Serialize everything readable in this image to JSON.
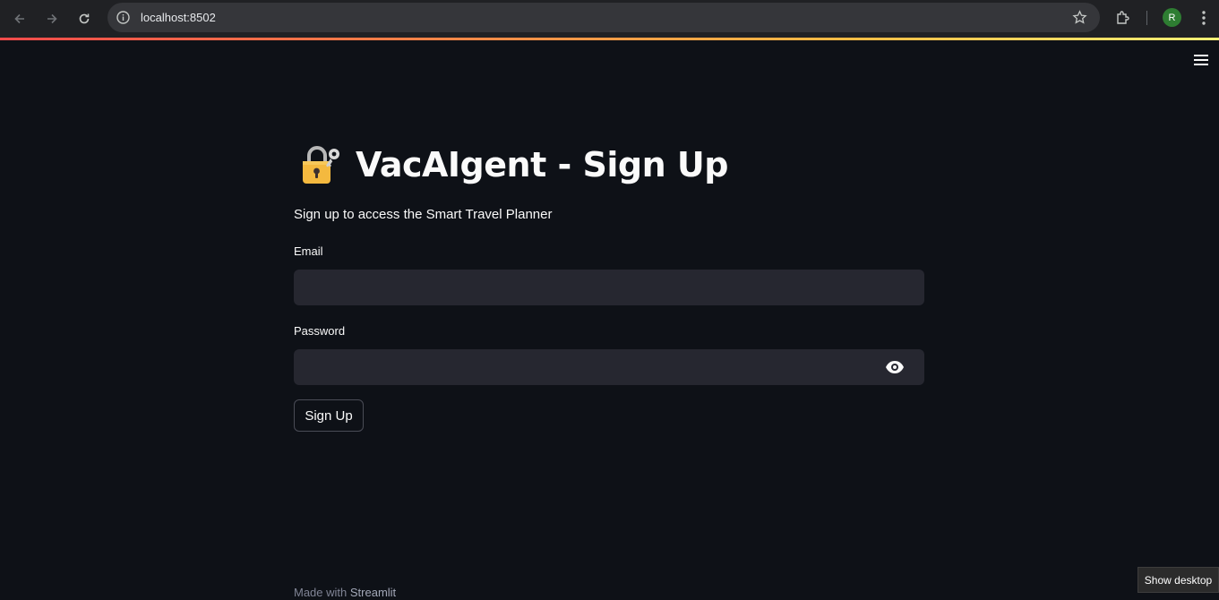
{
  "browser": {
    "url": "localhost:8502",
    "avatar_letter": "R"
  },
  "app": {
    "title": "VacAIgent - Sign Up",
    "subtitle": "Sign up to access the Smart Travel Planner",
    "email_label": "Email",
    "email_value": "",
    "password_label": "Password",
    "password_value": "",
    "signup_button": "Sign Up",
    "footer_prefix": "Made with ",
    "footer_brand": "Streamlit"
  },
  "os": {
    "tooltip": "Show desktop"
  },
  "colors": {
    "background": "#0e1117",
    "input_bg": "#262730",
    "text": "#fafafa",
    "accent_gradient_start": "#ff4b4b",
    "accent_gradient_end": "#fff176"
  }
}
